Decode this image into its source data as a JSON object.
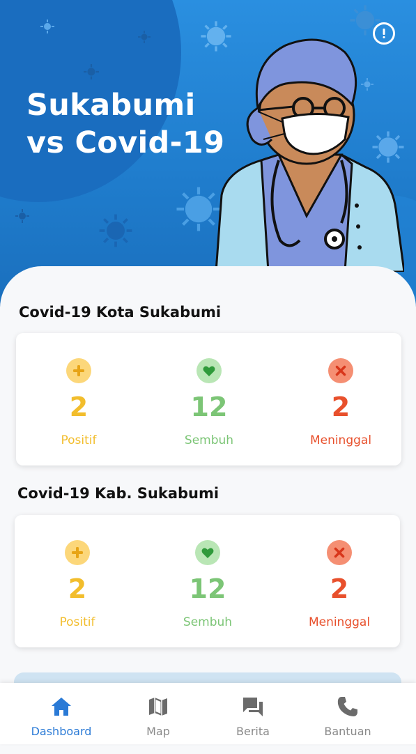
{
  "hero": {
    "title_line1": "Sukabumi",
    "title_line2": "vs Covid-19",
    "info_icon": "exclamation-circle-icon",
    "background_color": "#1f7ccc"
  },
  "colors": {
    "positif": "#f2bd2c",
    "sembuh": "#7cc576",
    "meninggal": "#e8502c",
    "nav_active": "#2a7ad6",
    "nav_inactive": "#8a8a8a"
  },
  "sections": [
    {
      "title": "Covid-19 Kota Sukabumi",
      "stats": [
        {
          "value": "2",
          "label": "Positif",
          "icon": "plus-icon"
        },
        {
          "value": "12",
          "label": "Sembuh",
          "icon": "heart-icon"
        },
        {
          "value": "2",
          "label": "Meninggal",
          "icon": "x-icon"
        }
      ]
    },
    {
      "title": "Covid-19 Kab. Sukabumi",
      "stats": [
        {
          "value": "2",
          "label": "Positif",
          "icon": "plus-icon"
        },
        {
          "value": "12",
          "label": "Sembuh",
          "icon": "heart-icon"
        },
        {
          "value": "2",
          "label": "Meninggal",
          "icon": "x-icon"
        }
      ]
    }
  ],
  "nav": {
    "items": [
      {
        "label": "Dashboard",
        "icon": "home-icon",
        "active": true
      },
      {
        "label": "Map",
        "icon": "map-icon",
        "active": false
      },
      {
        "label": "Berita",
        "icon": "chat-icon",
        "active": false
      },
      {
        "label": "Bantuan",
        "icon": "phone-icon",
        "active": false
      }
    ]
  }
}
